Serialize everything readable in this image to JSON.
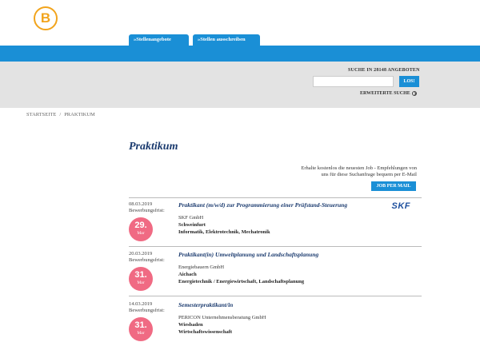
{
  "logo": {
    "letter": "B"
  },
  "tabs": [
    {
      "label": "»Stellenangebote"
    },
    {
      "label": "»Stellen ausschreiben"
    }
  ],
  "search": {
    "title": "SUCHE IN 28148 ANGEBOTEN",
    "placeholder": "",
    "button_label": "LOS!",
    "advanced_label": "ERWEITERTE SUCHE"
  },
  "breadcrumb": {
    "home": "STARTSEITE",
    "separator": "/",
    "current": "PRAKTIKUM"
  },
  "page_title": "Praktikum",
  "email_alert": {
    "text": "Erhalte kostenlos die neuesten Job - Empfehlungen von uns für diese Suchanfrage bequem per E-Mail",
    "button_label": "JOB PER MAIL"
  },
  "jobs": [
    {
      "date": "08.03.2019",
      "deadline_label": "Bewerbungsfrist:",
      "badge_day": "29.",
      "badge_month": "Mar",
      "title": "Praktikant (m/w/d) zur Programmierung einer Prüfstand-Steuerung",
      "company": "SKF GmbH",
      "city": "Schweinfurt",
      "category": "Informatik, Elektrotechnik, Mechatronik",
      "company_logo_text": "SKF"
    },
    {
      "date": "20.03.2019",
      "deadline_label": "Bewerbungsfrist:",
      "badge_day": "31.",
      "badge_month": "Mar",
      "title": "Praktikant(in) Umweltplanung und Landschaftsplanung",
      "company": "Energiebauern GmbH",
      "city": "Aichach",
      "category": "Energietechnik / Energiewirtschaft, Landschaftsplanung"
    },
    {
      "date": "14.03.2019",
      "deadline_label": "Bewerbungsfrist:",
      "badge_day": "31.",
      "badge_month": "Mar",
      "title": "Semesterpraktikant/in",
      "company": "PERICON Unternehmensberatung GmbH",
      "city": "Wiesbaden",
      "category": "Wirtschaftswissenschaft"
    }
  ],
  "colors": {
    "accent": "#1a8fd6",
    "title": "#1a3a6e",
    "badge": "#f06a83",
    "logo": "#f2a41c",
    "band": "#e3e3e3"
  }
}
